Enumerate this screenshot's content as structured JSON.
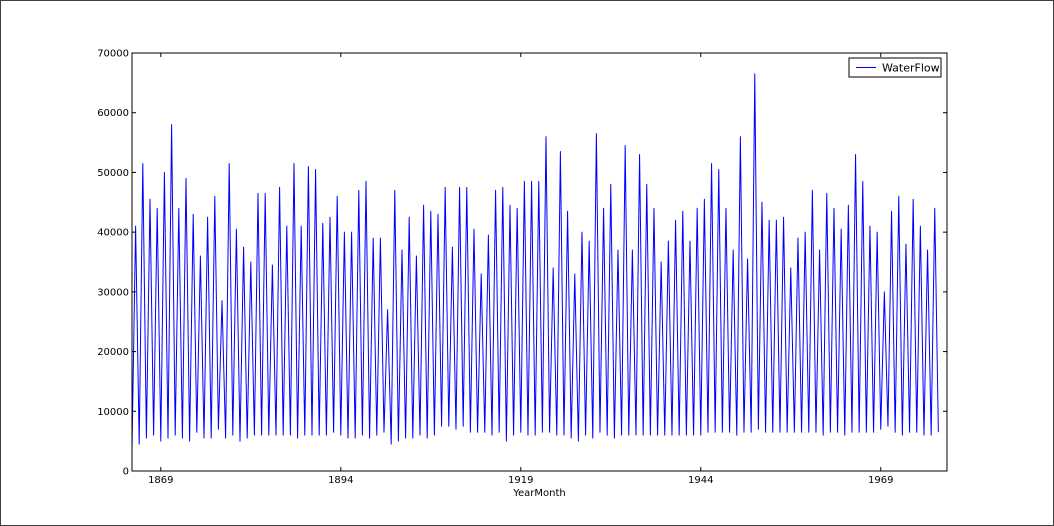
{
  "chart_data": {
    "type": "line",
    "title": "",
    "xlabel": "YearMonth",
    "ylabel": "",
    "xlim": [
      1865.0,
      1978.2
    ],
    "ylim": [
      0,
      70000
    ],
    "x_ticks": [
      1869,
      1894,
      1919,
      1944,
      1969
    ],
    "x_tick_labels": [
      "1869",
      "1894",
      "1919",
      "1944",
      "1969"
    ],
    "y_ticks": [
      0,
      10000,
      20000,
      30000,
      40000,
      50000,
      60000,
      70000
    ],
    "y_tick_labels": [
      "0",
      "10000",
      "20000",
      "30000",
      "40000",
      "50000",
      "60000",
      "70000"
    ],
    "grid": false,
    "legend": {
      "position": "top-right",
      "entries": [
        "WaterFlow"
      ]
    },
    "colors": {
      "series": "#0000ff",
      "axes": "#000000"
    },
    "series": [
      {
        "name": "WaterFlow",
        "x_start": 1865.0,
        "x_step": 0.5,
        "values": [
          3500,
          41000,
          4500,
          51500,
          5500,
          45500,
          6000,
          44000,
          5000,
          50000,
          5500,
          58000,
          6000,
          44000,
          5500,
          49000,
          5000,
          43000,
          6500,
          36000,
          5500,
          42500,
          5500,
          46000,
          7000,
          28500,
          5500,
          51500,
          6000,
          40500,
          5000,
          37500,
          5500,
          35000,
          6000,
          46500,
          6000,
          46500,
          6000,
          34500,
          6000,
          47500,
          6000,
          41000,
          6000,
          51500,
          5500,
          41000,
          6000,
          51000,
          6000,
          50500,
          6000,
          41500,
          6000,
          42500,
          6500,
          46000,
          6000,
          40000,
          5500,
          40000,
          5500,
          47000,
          6000,
          48500,
          5500,
          39000,
          6000,
          39000,
          6500,
          27000,
          4500,
          47000,
          5000,
          37000,
          5500,
          42500,
          5500,
          36000,
          6000,
          44500,
          5500,
          43500,
          6000,
          43000,
          7500,
          47500,
          7500,
          37500,
          7000,
          47500,
          7500,
          47500,
          6500,
          40500,
          6500,
          33000,
          6500,
          39500,
          6000,
          47000,
          6500,
          47500,
          5000,
          44500,
          6000,
          44000,
          6500,
          48500,
          6000,
          48500,
          6000,
          48500,
          6500,
          56000,
          6500,
          34000,
          6000,
          53500,
          6000,
          43500,
          5500,
          33000,
          5000,
          40000,
          6000,
          38500,
          5500,
          56500,
          6500,
          44000,
          6000,
          48000,
          5500,
          37000,
          6000,
          54500,
          6000,
          37000,
          6000,
          53000,
          6000,
          48000,
          6000,
          44000,
          6000,
          35000,
          6000,
          38500,
          6000,
          42000,
          6000,
          43500,
          6000,
          38500,
          6000,
          44000,
          6000,
          45500,
          6500,
          51500,
          6500,
          50500,
          6500,
          44000,
          6500,
          37000,
          6000,
          56000,
          6500,
          35500,
          6500,
          66500,
          7000,
          45000,
          6500,
          42000,
          6500,
          42000,
          6500,
          42500,
          6500,
          34000,
          6500,
          39000,
          6500,
          40000,
          6500,
          47000,
          6500,
          37000,
          6000,
          46500,
          6500,
          44000,
          6500,
          40500,
          6000,
          44500,
          6500,
          53000,
          6500,
          48500,
          6500,
          41000,
          6500,
          40000,
          7000,
          30000,
          7500,
          43500,
          6500,
          46000,
          6000,
          38000,
          6500,
          45500,
          6500,
          41000,
          6000,
          37000,
          6000,
          44000,
          6500
        ]
      }
    ]
  }
}
